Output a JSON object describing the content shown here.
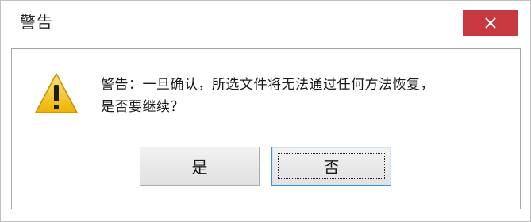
{
  "window": {
    "title": "警告"
  },
  "dialog": {
    "message": "警告：一旦确认，所选文件将无法通过任何方法恢复，\n是否要继续？",
    "icon": "warning-icon",
    "buttons": {
      "yes_label": "是",
      "no_label": "否",
      "default": "no"
    }
  },
  "colors": {
    "close_button": "#c8393f",
    "focus_border": "#3d8ee6",
    "warning_yellow": "#f5c01a"
  }
}
